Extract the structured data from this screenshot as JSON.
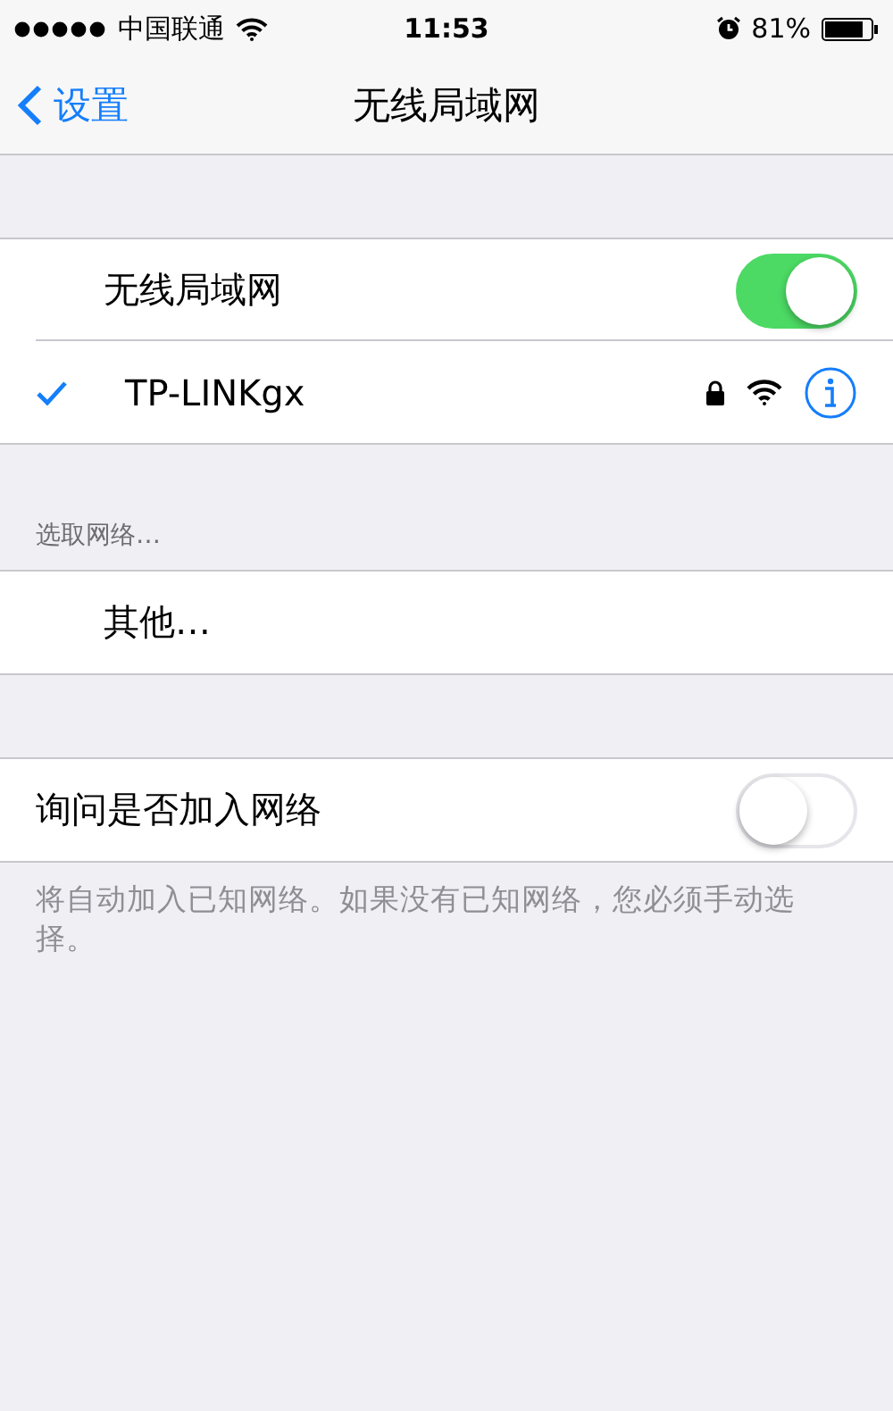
{
  "status_bar": {
    "carrier": "中国联通",
    "time": "11:53",
    "battery": "81%"
  },
  "nav": {
    "back": "设置",
    "title": "无线局域网"
  },
  "wifi_toggle": {
    "label": "无线局域网",
    "on": true
  },
  "connected_network": {
    "name": "TP-LINKgx",
    "selected": true,
    "secured": true
  },
  "choose_section": {
    "header": "选取网络…",
    "items": [
      {
        "label": "其他…"
      }
    ]
  },
  "ask_to_join": {
    "label": "询问是否加入网络",
    "on": false,
    "footer": "将自动加入已知网络。如果没有已知网络，您必须手动选择。"
  }
}
